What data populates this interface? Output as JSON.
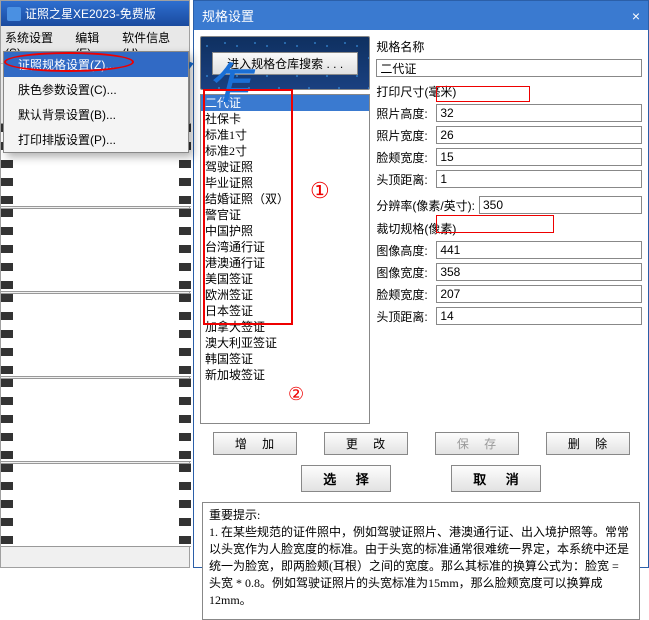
{
  "main_window": {
    "title": "证照之星XE2023-免费版",
    "menu": {
      "system": "系统设置(S)",
      "edit": "编辑(E)",
      "software": "软件信息(H)"
    },
    "dropdown": {
      "item0": "证照规格设置(Z)...",
      "item1": "肤色参数设置(C)...",
      "item2": "默认背景设置(B)...",
      "item3": "打印排版设置(P)..."
    },
    "banner": "丨亻乍"
  },
  "dialog": {
    "title": "规格设置",
    "search_btn": "进入规格仓库搜索 . . .",
    "list": {
      "i0": "二代证",
      "i1": "社保卡",
      "i2": "标准1寸",
      "i3": "标准2寸",
      "i4": "驾驶证照",
      "i5": "毕业证照",
      "i6": "结婚证照（双）",
      "i7": "警官证",
      "i8": "中国护照",
      "i9": "台湾通行证",
      "i10": "港澳通行证",
      "i11": "美国签证",
      "i12": "欧洲签证",
      "i13": "日本签证",
      "i14": "加拿大签证",
      "i15": "澳大利亚签证",
      "i16": "韩国签证",
      "i17": "新加坡签证"
    },
    "labels": {
      "spec_name": "规格名称",
      "print_size": "打印尺寸(毫米)",
      "photo_h": "照片高度:",
      "photo_w": "照片宽度:",
      "face_w": "脸颊宽度:",
      "head_top": "头顶距离:",
      "dpi": "分辨率(像素/英寸):",
      "crop": "裁切规格(像素)",
      "img_h": "图像高度:",
      "img_w": "图像宽度:"
    },
    "values": {
      "spec_name": "二代证",
      "photo_h": "32",
      "photo_w": "26",
      "face_w": "15",
      "head_top": "1",
      "dpi": "350",
      "img_h": "441",
      "img_w": "358",
      "crop_face_w": "207",
      "crop_head_top": "14"
    },
    "buttons": {
      "add": "增 加",
      "modify": "更 改",
      "save": "保 存",
      "delete": "删 除",
      "select": "选 择",
      "cancel": "取 消"
    },
    "annot1": "①",
    "annot2": "②",
    "hint_title": "重要提示:",
    "hint_body": "1. 在某些规范的证件照中，例如驾驶证照片、港澳通行证、出入境护照等。常常以头宽作为人脸宽度的标准。由于头宽的标准通常很难统一界定，本系统中还是统一为脸宽，即两脸颊(耳根）之间的宽度。那么其标准的换算公式为：脸宽 = 头宽 * 0.8。例如驾驶证照片的头宽标准为15mm，那么脸颊宽度可以换算成12mm。"
  }
}
